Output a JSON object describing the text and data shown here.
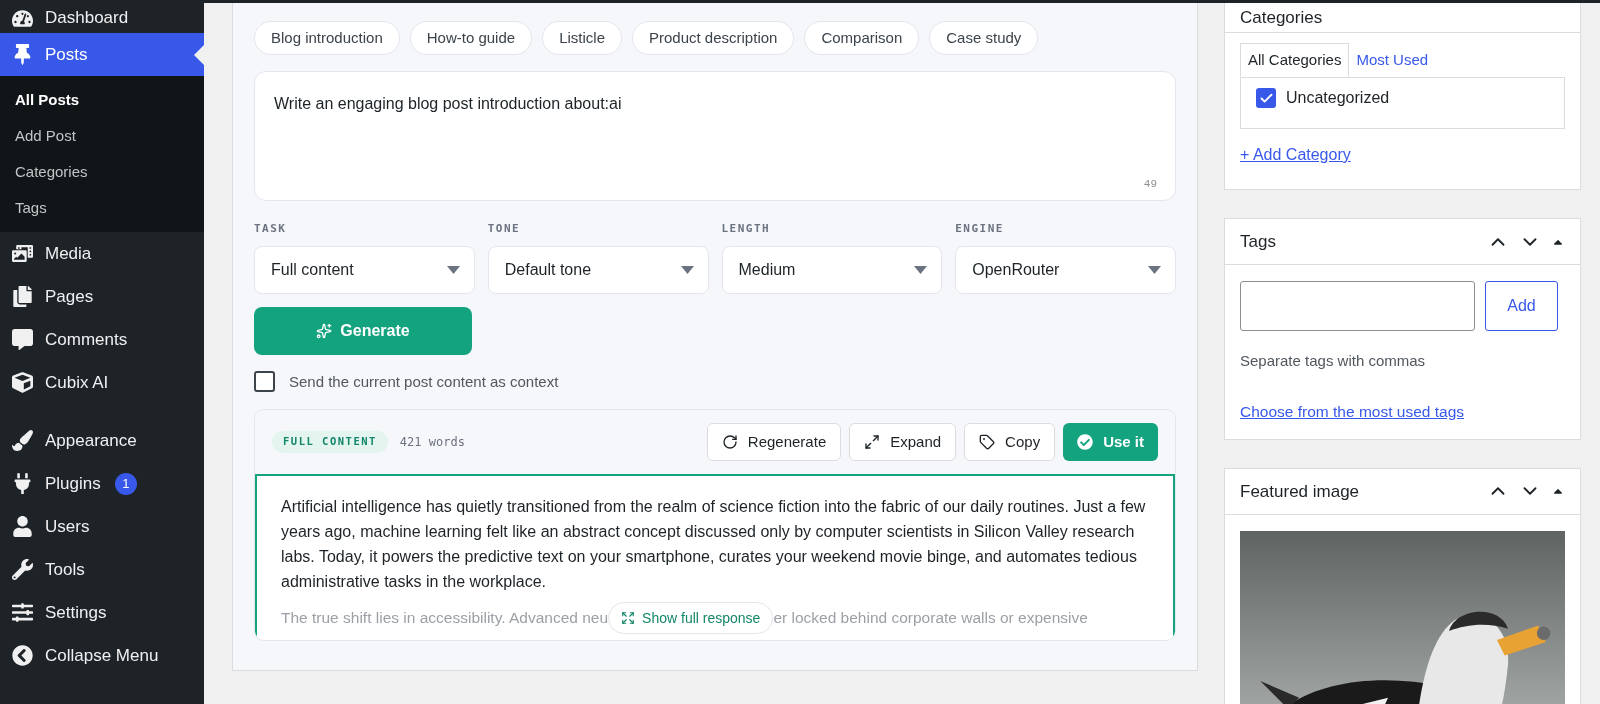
{
  "sidebar": {
    "items": [
      {
        "label": "Dashboard",
        "selected": false
      },
      {
        "label": "Posts",
        "selected": true,
        "children": [
          {
            "label": "All Posts",
            "selected": true
          },
          {
            "label": "Add Post",
            "selected": false
          },
          {
            "label": "Categories",
            "selected": false
          },
          {
            "label": "Tags",
            "selected": false
          }
        ]
      },
      {
        "label": "Media",
        "selected": false
      },
      {
        "label": "Pages",
        "selected": false
      },
      {
        "label": "Comments",
        "selected": false
      },
      {
        "label": "Cubix AI",
        "selected": false
      },
      {
        "label": "Appearance",
        "selected": false
      },
      {
        "label": "Plugins",
        "selected": false,
        "badge": "1"
      },
      {
        "label": "Users",
        "selected": false
      },
      {
        "label": "Tools",
        "selected": false
      },
      {
        "label": "Settings",
        "selected": false
      },
      {
        "label": "Collapse Menu",
        "selected": false
      }
    ]
  },
  "templates": [
    "Blog introduction",
    "How-to guide",
    "Listicle",
    "Product description",
    "Comparison",
    "Case study"
  ],
  "prompt": {
    "value": "Write an engaging blog post introduction about:ai",
    "counter": "49"
  },
  "selects": [
    {
      "label": "TASK",
      "value": "Full content"
    },
    {
      "label": "TONE",
      "value": "Default tone"
    },
    {
      "label": "LENGTH",
      "value": "Medium"
    },
    {
      "label": "ENGINE",
      "value": "OpenRouter"
    }
  ],
  "generate_button": "Generate",
  "context_option": {
    "label": "Send the current post content as context",
    "checked": false
  },
  "result": {
    "badge": "FULL CONTENT",
    "word_count": "421 words",
    "actions": [
      {
        "label": "Regenerate",
        "primary": false
      },
      {
        "label": "Expand",
        "primary": false
      },
      {
        "label": "Copy",
        "primary": false
      },
      {
        "label": "Use it",
        "primary": true
      }
    ],
    "paragraph": "Artificial intelligence has quietly transitioned from the realm of science fiction into the fabric of our daily routines. Just a few years ago, machine learning felt like an abstract concept discussed only by computer scientists in Silicon Valley research labs. Today, it powers the predictive text on your smartphone, curates your weekend movie binge, and automates tedious administrative tasks in the workplace.",
    "faded_start": "The true shift lies in accessibility. Advanced neu",
    "faded_end": "er locked behind corporate walls or expensive",
    "show_button": "Show full response"
  },
  "categories": {
    "title": "Categories",
    "tabs": [
      {
        "label": "All Categories",
        "selected": true
      },
      {
        "label": "Most Used",
        "selected": false
      }
    ],
    "items": [
      {
        "label": "Uncategorized",
        "checked": true
      }
    ],
    "add_link": "+ Add Category"
  },
  "tags": {
    "title": "Tags",
    "add_button": "Add",
    "hint": "Separate tags with commas",
    "link": "Choose from the most used tags"
  },
  "featured_image": {
    "title": "Featured image"
  }
}
